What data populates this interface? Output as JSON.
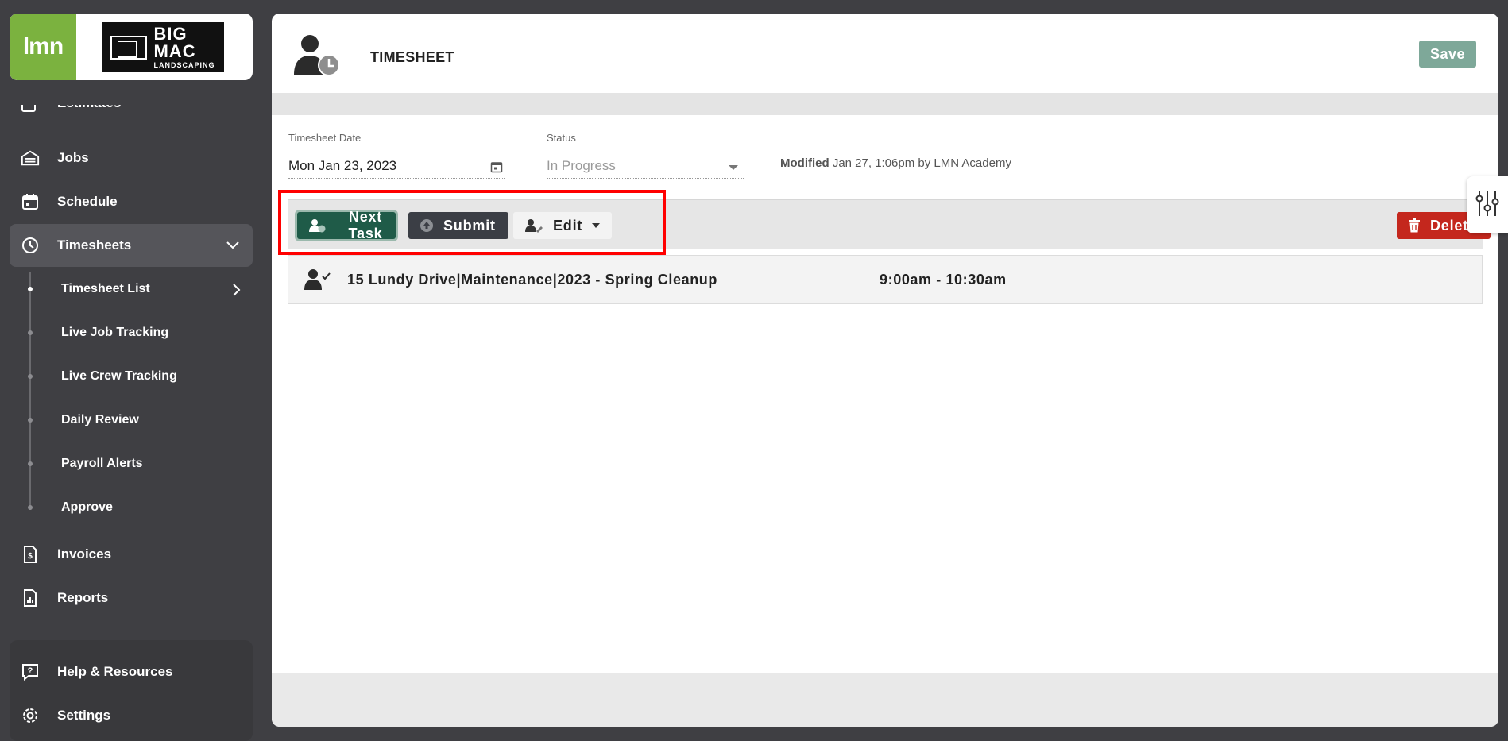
{
  "brand": {
    "lmn_logo": "lmn",
    "company_big": "BIG",
    "company_mac": "MAC",
    "company_sub": "LANDSCAPING"
  },
  "sidebar": {
    "cut_item": "Estimates",
    "items": [
      {
        "label": "Jobs",
        "icon": "jobs-icon"
      },
      {
        "label": "Schedule",
        "icon": "calendar-icon"
      },
      {
        "label": "Timesheets",
        "icon": "clock-icon"
      }
    ],
    "sub_items": [
      {
        "label": "Timesheet List"
      },
      {
        "label": "Live Job Tracking"
      },
      {
        "label": "Live Crew Tracking"
      },
      {
        "label": "Daily Review"
      },
      {
        "label": "Payroll Alerts"
      },
      {
        "label": "Approve"
      }
    ],
    "items_after": [
      {
        "label": "Invoices",
        "icon": "invoice-icon"
      },
      {
        "label": "Reports",
        "icon": "report-icon"
      }
    ],
    "bottom": [
      {
        "label": "Help & Resources",
        "icon": "help-icon"
      },
      {
        "label": "Settings",
        "icon": "gear-icon"
      }
    ]
  },
  "header": {
    "title": "TIMESHEET",
    "save_label": "Save"
  },
  "form": {
    "date_label": "Timesheet Date",
    "date_value": "Mon Jan 23, 2023",
    "status_label": "Status",
    "status_value": "In Progress",
    "modified_label": "Modified",
    "modified_value": "Jan 27, 1:06pm by LMN Academy"
  },
  "toolbar": {
    "next_task": "Next Task",
    "submit": "Submit",
    "edit": "Edit",
    "delete": "Delete"
  },
  "tasks": [
    {
      "name": "15 Lundy Drive|Maintenance|2023 - Spring Cleanup",
      "time": "9:00am - 10:30am"
    }
  ],
  "colors": {
    "sidebar_bg": "#3f3f43",
    "lmn_green": "#7bb23f",
    "next_task_bg": "#1f5b48",
    "submit_bg": "#3b3e45",
    "delete_bg": "#c4271d",
    "save_bg": "#7ea899",
    "highlight": "#ff0000"
  }
}
